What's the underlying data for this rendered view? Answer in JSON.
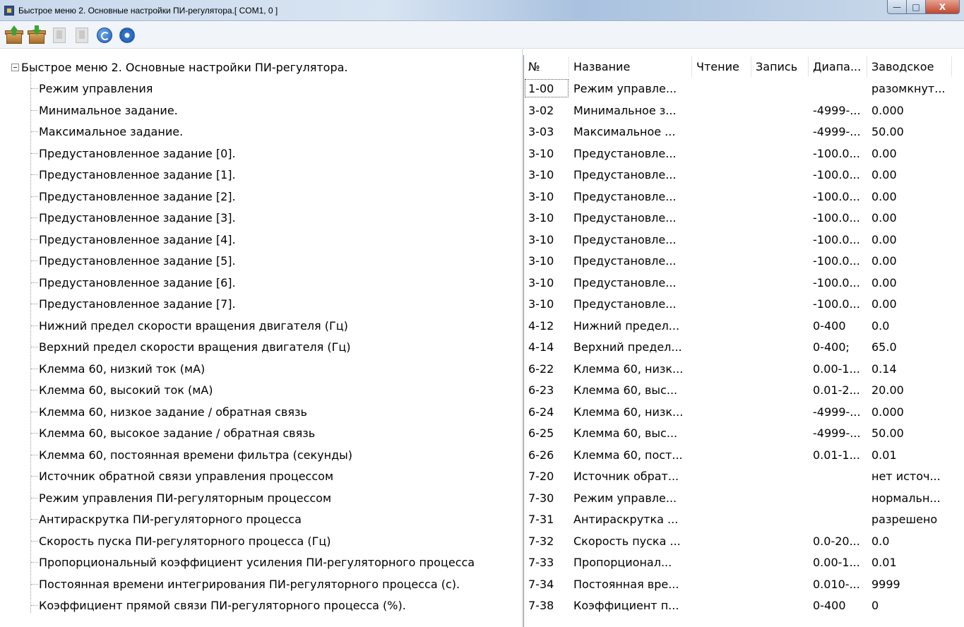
{
  "window": {
    "title": "Быстрое меню 2. Основные настройки ПИ-регулятора.[ COM1, 0 ]",
    "icon": "app-icon",
    "controls": {
      "minimize": "—",
      "maximize": "□",
      "close": "X"
    }
  },
  "toolbar": {
    "buttons": [
      {
        "name": "upload-box-icon",
        "enabled": true
      },
      {
        "name": "download-box-icon",
        "enabled": true
      },
      {
        "name": "upload-grey-icon",
        "enabled": false
      },
      {
        "name": "download-grey-icon",
        "enabled": false
      },
      {
        "name": "refresh-icon",
        "enabled": true
      },
      {
        "name": "gear-icon",
        "enabled": true
      }
    ]
  },
  "tree": {
    "root": "Быстрое меню 2. Основные настройки ПИ-регулятора.",
    "items": [
      "Режим управления",
      "Минимальное задание.",
      "Максимальное задание.",
      "Предустановленное задание [0].",
      "Предустановленное задание [1].",
      "Предустановленное задание [2].",
      "Предустановленное задание [3].",
      "Предустановленное задание [4].",
      "Предустановленное задание [5].",
      "Предустановленное задание [6].",
      "Предустановленное задание [7].",
      "Нижний предел скорости вращения двигателя (Гц)",
      "Верхний предел скорости вращения двигателя (Гц)",
      "Клемма 60, низкий ток (мА)",
      "Клемма 60, высокий ток (мА)",
      "Клемма 60, низкое задание / обратная связь",
      "Клемма 60, высокое задание / обратная связь",
      "Клемма 60, постоянная времени фильтра (секунды)",
      "Источник обратной связи управления процессом",
      "Режим управления ПИ-регуляторным процессом",
      "Антираскрутка ПИ-регуляторного процесса",
      "Скорость пуска ПИ-регуляторного процесса (Гц)",
      "Пропорциональный коэффициент усиления ПИ-регуляторного процесса",
      "Постоянная времени интегрирования ПИ-регуляторного процесса (с).",
      "Коэффициент прямой связи ПИ-регуляторного процесса (%)."
    ]
  },
  "table": {
    "columns": [
      "№",
      "Название",
      "Чтение",
      "Запись",
      "Диапа...",
      "Заводское"
    ],
    "rows": [
      [
        "1-00",
        "Режим управле...",
        "",
        "",
        "",
        "разомкнут..."
      ],
      [
        "3-02",
        "Минимальное з...",
        "",
        "",
        "-4999-...",
        "0.000"
      ],
      [
        "3-03",
        "Максимальное ...",
        "",
        "",
        "-4999-...",
        "50.00"
      ],
      [
        "3-10",
        "Предустановле...",
        "",
        "",
        "-100.0...",
        "0.00"
      ],
      [
        "3-10",
        "Предустановле...",
        "",
        "",
        "-100.0...",
        "0.00"
      ],
      [
        "3-10",
        "Предустановле...",
        "",
        "",
        "-100.0...",
        "0.00"
      ],
      [
        "3-10",
        "Предустановле...",
        "",
        "",
        "-100.0...",
        "0.00"
      ],
      [
        "3-10",
        "Предустановле...",
        "",
        "",
        "-100.0...",
        "0.00"
      ],
      [
        "3-10",
        "Предустановле...",
        "",
        "",
        "-100.0...",
        "0.00"
      ],
      [
        "3-10",
        "Предустановле...",
        "",
        "",
        "-100.0...",
        "0.00"
      ],
      [
        "3-10",
        "Предустановле...",
        "",
        "",
        "-100.0...",
        "0.00"
      ],
      [
        "4-12",
        "Нижний предел...",
        "",
        "",
        "0-400",
        "0.0"
      ],
      [
        "4-14",
        "Верхний предел...",
        "",
        "",
        "0-400;",
        "65.0"
      ],
      [
        "6-22",
        "Клемма 60, низк...",
        "",
        "",
        "0.00-1...",
        "0.14"
      ],
      [
        "6-23",
        "Клемма 60, выс...",
        "",
        "",
        "0.01-2...",
        "20.00"
      ],
      [
        "6-24",
        "Клемма 60, низк...",
        "",
        "",
        "-4999-...",
        "0.000"
      ],
      [
        "6-25",
        "Клемма 60, выс...",
        "",
        "",
        "-4999-...",
        "50.00"
      ],
      [
        "6-26",
        "Клемма 60, пост...",
        "",
        "",
        "0.01-1...",
        "0.01"
      ],
      [
        "7-20",
        "Источник обрат...",
        "",
        "",
        "",
        "нет источ..."
      ],
      [
        "7-30",
        "Режим управле...",
        "",
        "",
        "",
        "нормальн..."
      ],
      [
        "7-31",
        "Антираскрутка ...",
        "",
        "",
        "",
        "разрешено"
      ],
      [
        "7-32",
        "Скорость пуска ...",
        "",
        "",
        "0.0-20...",
        "0.0"
      ],
      [
        "7-33",
        "Пропорционал...",
        "",
        "",
        "0.00-1...",
        "0.01"
      ],
      [
        "7-34",
        "Постоянная вре...",
        "",
        "",
        "0.010-...",
        "9999"
      ],
      [
        "7-38",
        "Коэффициент п...",
        "",
        "",
        "0-400",
        "0"
      ]
    ]
  }
}
